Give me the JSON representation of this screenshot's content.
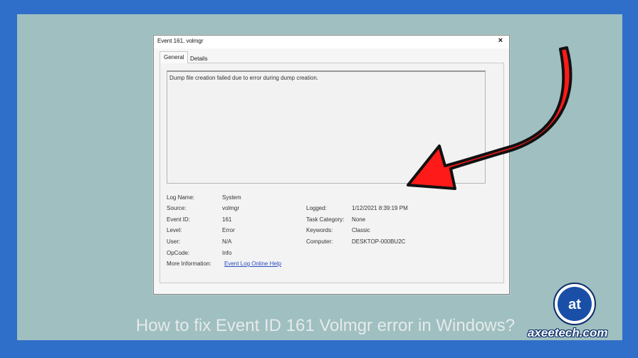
{
  "dialog": {
    "title": "Event 161, volmgr",
    "close_label": "×",
    "tabs": [
      {
        "label": "General"
      },
      {
        "label": "Details"
      }
    ],
    "message": "Dump file creation failed due to error during dump creation.",
    "left_fields": [
      {
        "label": "Log Name:",
        "value": "System"
      },
      {
        "label": "Source:",
        "value": "volmgr"
      },
      {
        "label": "Event ID:",
        "value": "161"
      },
      {
        "label": "Level:",
        "value": "Error"
      },
      {
        "label": "User:",
        "value": "N/A"
      },
      {
        "label": "OpCode:",
        "value": "Info"
      },
      {
        "label": "More Information:",
        "value": "Event Log Online Help"
      }
    ],
    "right_fields": [
      {
        "label": "Logged:",
        "value": "1/12/2021 8:39:19 PM"
      },
      {
        "label": "Task Category:",
        "value": "None"
      },
      {
        "label": "Keywords:",
        "value": "Classic"
      },
      {
        "label": "Computer:",
        "value": "DESKTOP-000BU2C"
      }
    ]
  },
  "caption": "How to fix Event ID 161 Volmgr error in Windows?",
  "brand": {
    "text": "axeetech.com",
    "logo_letters": "at",
    "icon": "axeetech-logo-icon"
  },
  "annotation": {
    "icon": "red-curved-arrow-icon",
    "color": "#ff1a1a"
  },
  "colors": {
    "frame": "#2f6fc9",
    "background": "#9fbfc0",
    "link": "#2a4fbf"
  }
}
